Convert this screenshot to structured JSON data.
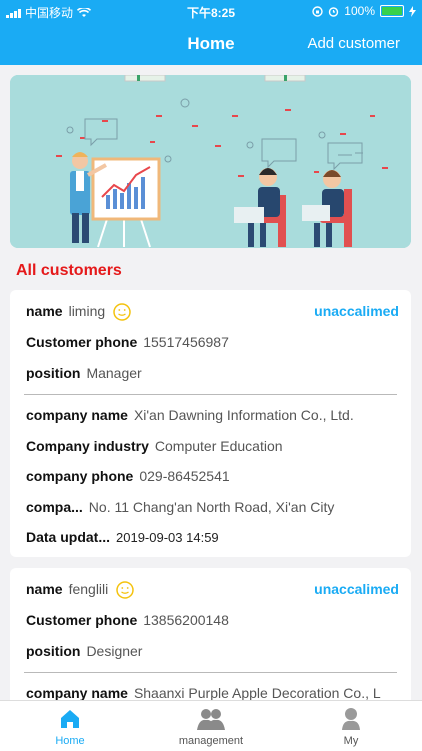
{
  "status_bar": {
    "carrier": "中国移动",
    "time": "下午8:25",
    "battery": "100%"
  },
  "nav": {
    "title": "Home",
    "action": "Add customer"
  },
  "section_title": "All customers",
  "customers": [
    {
      "name_label": "name",
      "name": "liming",
      "status": "unaccalimed",
      "phone_label": "Customer phone",
      "phone": "15517456987",
      "position_label": "position",
      "position": "Manager",
      "company_name_label": "company name",
      "company_name": "Xi'an Dawning Information Co., Ltd.",
      "industry_label": "Company industry",
      "industry": "Computer Education",
      "company_phone_label": "company phone",
      "company_phone": "029-86452541",
      "address_label": "compa...",
      "address": "No. 11 Chang'an North Road, Xi'an City",
      "updated_label": "Data updat...",
      "updated": "2019-09-03 14:59"
    },
    {
      "name_label": "name",
      "name": "fenglili",
      "status": "unaccalimed",
      "phone_label": "Customer phone",
      "phone": "13856200148",
      "position_label": "position",
      "position": "Designer",
      "company_name_label": "company name",
      "company_name": "Shaanxi Purple Apple Decoration Co., L"
    }
  ],
  "tabs": [
    {
      "label": "Home",
      "icon": "home-icon"
    },
    {
      "label": "management",
      "icon": "people-icon"
    },
    {
      "label": "My",
      "icon": "person-icon"
    }
  ],
  "colors": {
    "accent": "#1aabf4",
    "section_title": "#e5191a",
    "status_text": "#1aabf4",
    "battery_fill": "#38d14b"
  }
}
